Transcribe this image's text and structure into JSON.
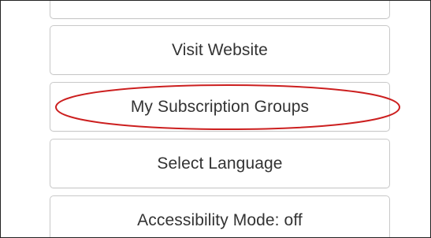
{
  "menu": {
    "top_partial_label": "",
    "items": [
      {
        "label": "Visit Website"
      },
      {
        "label": "My Subscription Groups"
      },
      {
        "label": "Select Language"
      },
      {
        "label": "Accessibility Mode: off"
      }
    ]
  },
  "annotation": {
    "highlight_color": "#cc1f1f",
    "highlight_target": "My Subscription Groups"
  },
  "colors": {
    "button_border": "#c9c9c9",
    "button_text": "#333333",
    "frame_border": "#222222",
    "background": "#ffffff"
  }
}
